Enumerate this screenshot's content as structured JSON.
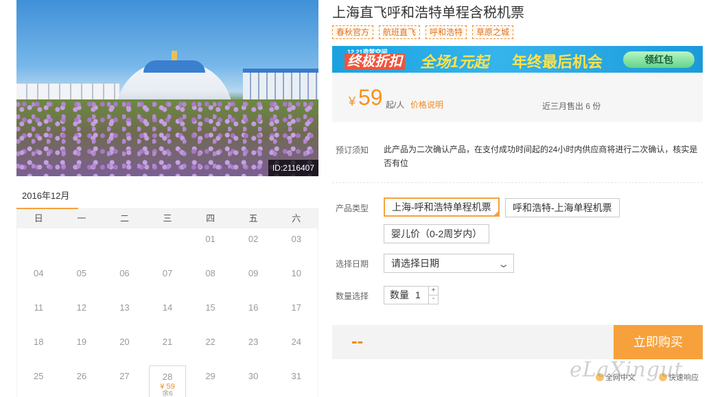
{
  "photo": {
    "id_label": "ID:2116407"
  },
  "calendar": {
    "month": "2016年12月",
    "weekdays": [
      "日",
      "一",
      "二",
      "三",
      "四",
      "五",
      "六"
    ],
    "weeks": [
      [
        "",
        "",
        "",
        "",
        "01",
        "02",
        "03"
      ],
      [
        "04",
        "05",
        "06",
        "07",
        "08",
        "09",
        "10"
      ],
      [
        "11",
        "12",
        "13",
        "14",
        "15",
        "16",
        "17"
      ],
      [
        "18",
        "19",
        "20",
        "21",
        "22",
        "23",
        "24"
      ],
      [
        "25",
        "26",
        "27",
        "28",
        "29",
        "30",
        "31"
      ]
    ],
    "selected": {
      "day": "28",
      "price": "¥ 59",
      "remaining": "余6"
    }
  },
  "product": {
    "title": "上海直飞呼和浩特单程含税机票",
    "tags": [
      "春秋官方",
      "航班直飞",
      "呼和浩特",
      "草原之城"
    ]
  },
  "banner": {
    "small": "12.21造梦空间",
    "big": "终极折扣",
    "mid": "全场1元起",
    "mid2": "年终最后机会",
    "button": "领红包"
  },
  "price": {
    "currency": "¥",
    "amount": "59",
    "unit": "起/人",
    "explain": "价格说明",
    "sold": "近三月售出 6 份"
  },
  "notice": {
    "label": "预订须知",
    "text": "此产品为二次确认产品，在支付成功时间起的24小时内供应商将进行二次确认，核实是否有位"
  },
  "options": {
    "label": "产品类型",
    "items": [
      "上海-呼和浩特单程机票",
      "呼和浩特-上海单程机票",
      "婴儿价（0-2周岁内）"
    ]
  },
  "date": {
    "label": "选择日期",
    "placeholder": "请选择日期"
  },
  "quantity": {
    "label": "数量选择",
    "inner_label": "数量",
    "value": "1",
    "plus": "+",
    "minus": "-"
  },
  "buy": {
    "total": "--",
    "button": "立即购买"
  },
  "assurance": [
    "全网中文",
    "快速响应"
  ],
  "watermark": "eLaXingut",
  "colors": {
    "accent": "#f7a13c",
    "price": "#f7931e",
    "tag": "#e2701a"
  }
}
